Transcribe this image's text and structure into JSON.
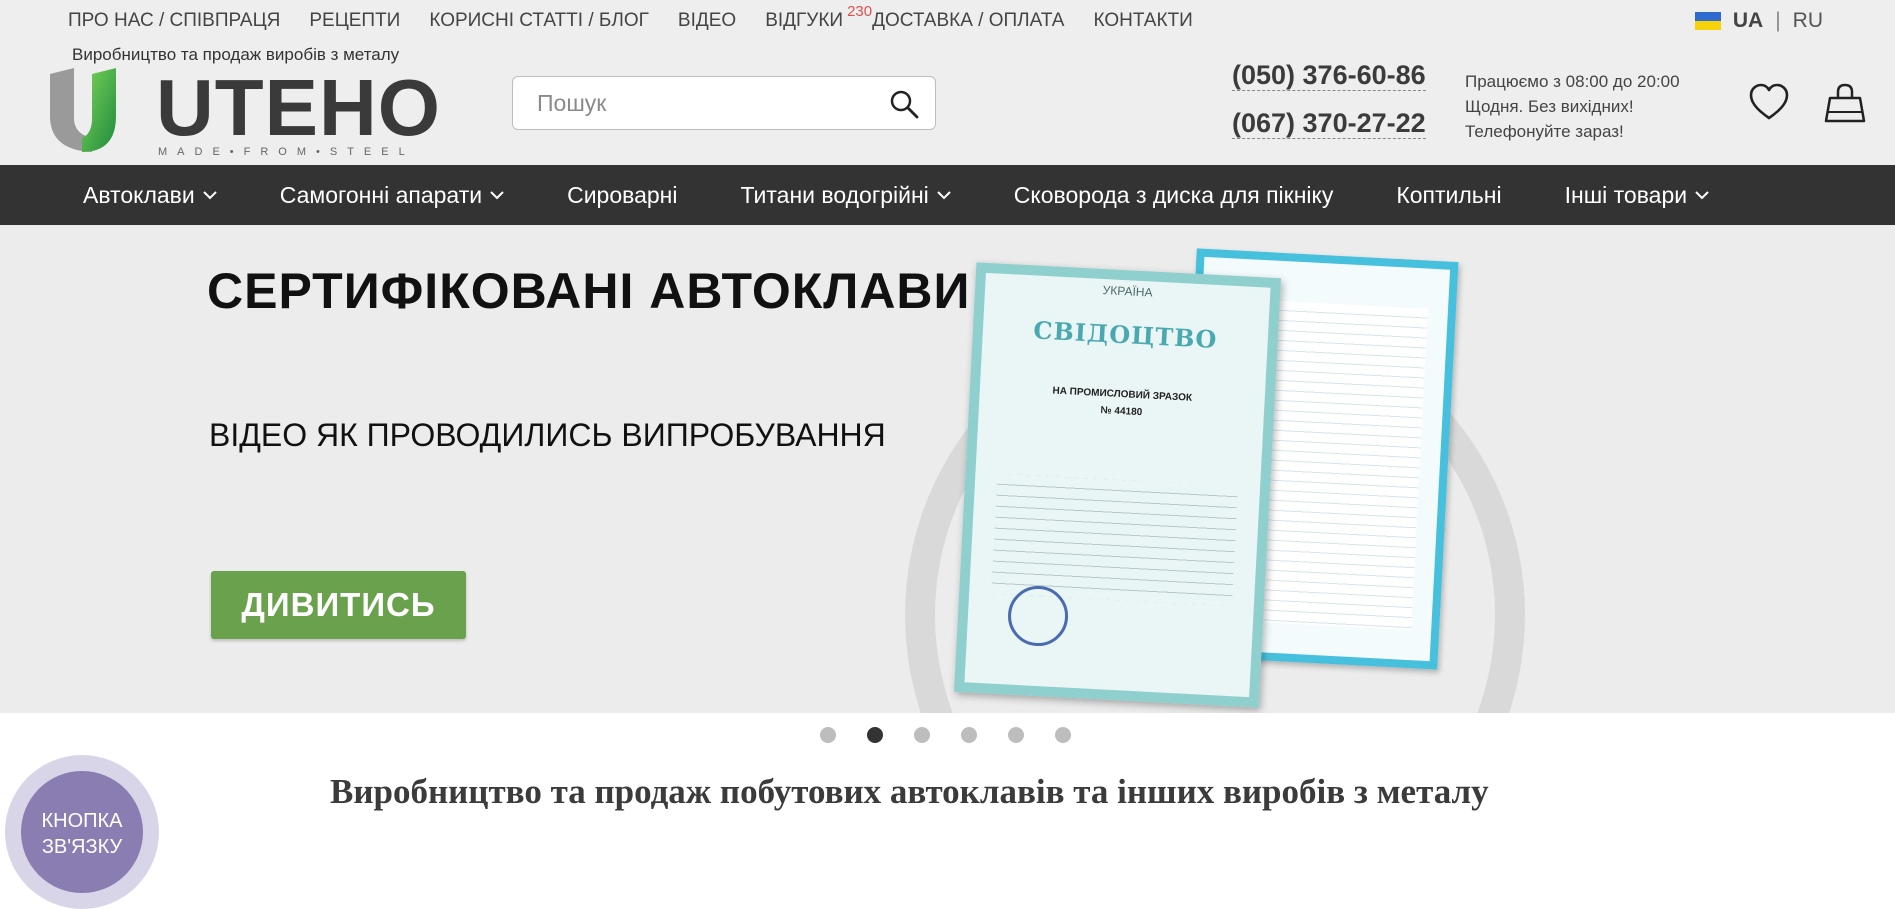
{
  "top_links": [
    {
      "label": "ПРО НАС / СПІВПРАЦЯ"
    },
    {
      "label": "РЕЦЕПТИ"
    },
    {
      "label": "КОРИСНІ СТАТТІ / БЛОГ"
    },
    {
      "label": "ВІДЕО"
    },
    {
      "label": "ВІДГУКИ",
      "badge": "230"
    },
    {
      "label": "ДОСТАВКА / ОПЛАТА"
    },
    {
      "label": "КОНТАКТИ"
    }
  ],
  "languages": {
    "active": "UA",
    "separator": "|",
    "other": "RU"
  },
  "header": {
    "tagline": "Виробництво та продаж виробів з металу",
    "logo_text": "UTEHO",
    "logo_sub": "MADE•FROM•STEEL",
    "search_placeholder": "Пошук",
    "phones": [
      "(050) 376-60-86",
      "(067) 370-27-22"
    ],
    "hours": [
      "Працюємо з 08:00 до 20:00",
      "Щодня. Без вихідних!",
      "Телефонуйте зараз!"
    ]
  },
  "nav": [
    {
      "label": "Автоклави",
      "dropdown": true
    },
    {
      "label": "Самогонні апарати",
      "dropdown": true
    },
    {
      "label": "Сироварні",
      "dropdown": false
    },
    {
      "label": "Титани водогрійні",
      "dropdown": true
    },
    {
      "label": "Сковорода з диска для пікніку",
      "dropdown": false
    },
    {
      "label": "Коптильні",
      "dropdown": false
    },
    {
      "label": "Інші товари",
      "dropdown": true
    }
  ],
  "banner": {
    "title": "СЕРТИФІКОВАНІ АВТОКЛАВИ",
    "subtitle": "ВІДЕО ЯК ПРОВОДИЛИСЬ ВИПРОБУВАННЯ",
    "button": "ДИВИТИСЬ",
    "cert_top": "УКРАЇНА",
    "cert_title": "СВІДОЦТВО",
    "cert_line": "НА ПРОМИСЛОВИЙ ЗРАЗОК",
    "cert_number": "№ 44180"
  },
  "slider": {
    "count": 6,
    "active": 2
  },
  "page_title": "Виробництво та продаж побутових автоклавів та інших виробів з металу",
  "contact_button": {
    "line1": "КНОПКА",
    "line2": "ЗВ'ЯЗКУ"
  },
  "colors": {
    "accent_green": "#6aa14d",
    "nav_bg": "#333333",
    "contact_purple": "#8a7db1",
    "badge_red": "#d9534f"
  }
}
